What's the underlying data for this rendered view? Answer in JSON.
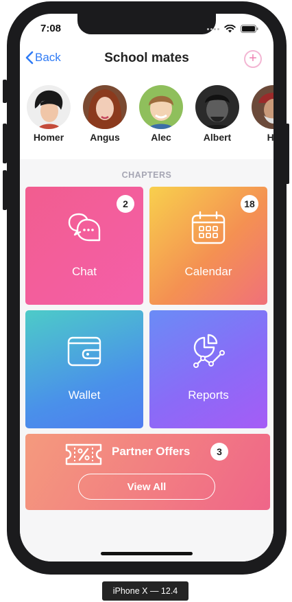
{
  "status": {
    "time": "7:08"
  },
  "nav": {
    "back_label": "Back",
    "title": "School mates",
    "add_label": "+"
  },
  "people": [
    {
      "name": "Homer"
    },
    {
      "name": "Angus"
    },
    {
      "name": "Alec"
    },
    {
      "name": "Albert"
    },
    {
      "name": "Hu"
    }
  ],
  "section": {
    "title": "CHAPTERS"
  },
  "tiles": {
    "chat": {
      "label": "Chat",
      "badge": "2"
    },
    "calendar": {
      "label": "Calendar",
      "badge": "18"
    },
    "wallet": {
      "label": "Wallet"
    },
    "reports": {
      "label": "Reports"
    }
  },
  "offers": {
    "title": "Partner Offers",
    "badge": "3",
    "button_label": "View All"
  },
  "caption": {
    "text": "iPhone X — 12.4"
  },
  "colors": {
    "accent": "#2f7bf5",
    "chat_gradient": [
      "#f25d8f",
      "#f45fa9"
    ],
    "calendar_gradient": [
      "#f8d04d",
      "#f0707a"
    ],
    "wallet_gradient": [
      "#4dcbc8",
      "#4f7cf0"
    ],
    "reports_gradient": [
      "#6a8cf6",
      "#a55cf6"
    ],
    "offers_gradient": [
      "#f49a7d",
      "#ef6589"
    ]
  }
}
